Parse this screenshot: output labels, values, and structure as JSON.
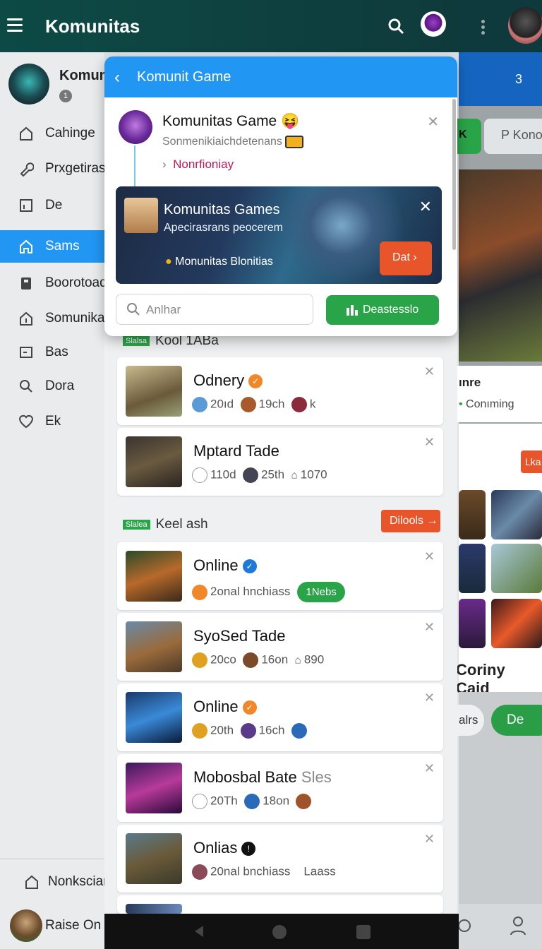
{
  "topbar": {
    "title": "Komunitas"
  },
  "right": {
    "blue_badge": "3",
    "btn_dark": "K",
    "btn_light": "P Kono",
    "card_title": "ınre",
    "card_sub": "Conıming",
    "label": "Lka",
    "caption": "Coriny Caid",
    "pill1": "alrs",
    "pill2": "De"
  },
  "drawer": {
    "name": "Komunı",
    "badge": "1",
    "items": [
      {
        "label": "Cahinge",
        "icon": "house-icon"
      },
      {
        "label": "Prxgetiras",
        "icon": "wrench-icon"
      },
      {
        "label": "De",
        "icon": "calendar-icon"
      },
      {
        "label": "Sams",
        "icon": "home-icon",
        "active": true
      },
      {
        "label": "Boorotoad",
        "icon": "clipboard-icon"
      },
      {
        "label": "Somunika",
        "icon": "home-outline-icon"
      },
      {
        "label": "Bas",
        "icon": "minus-box-icon"
      },
      {
        "label": "Dora",
        "icon": "search-icon"
      },
      {
        "label": "Ek",
        "icon": "heart-icon"
      }
    ],
    "bottom1": "Nonksciar",
    "bottom2": "Raise On"
  },
  "popup": {
    "header": "Komunit Game",
    "title": "Komunitas Game",
    "subtitle": "Sonmenikiaichdetenans",
    "notif": "Nonrfioniay",
    "banner": {
      "title": "Komunitas Games",
      "sub": "Apecirasrans peocerem",
      "label": "Monunitas Blonitias",
      "btn": "Dat"
    },
    "search_placeholder": "Anlhar",
    "green_btn": "Deastesslo"
  },
  "sections": [
    {
      "tag": "Slalsa",
      "title": "Kool 1ABa"
    },
    {
      "tag": "Slalea",
      "title": "Keel ash",
      "btn": "Dilools"
    }
  ],
  "cards": [
    {
      "title": "Odnery",
      "badge_color": "#f0882a",
      "m1": "20ıd",
      "m2": "19ch",
      "m3": "k",
      "m1c": "#5b9bd5",
      "m2c": "#a85a2a",
      "m3c": "#8a2a3a",
      "thumb": "linear-gradient(160deg,#c9b98f,#6a5a3a 60%,#9aa07a)"
    },
    {
      "title": "Mptard Tade",
      "badge_color": "",
      "m1": "110d",
      "m2": "25th",
      "m3": "1070",
      "m1c": "#ddd",
      "m2c": "#445",
      "m3c": "#eee",
      "thumb": "linear-gradient(160deg,#3a3530,#6a5a40 50%,#2a2520)"
    },
    {
      "title": "Online",
      "badge_color": "#1e7ad8",
      "m1": "2onal hnchiass",
      "m2": "",
      "m3": "",
      "green": "1Nebs",
      "m1c": "#f0882a",
      "thumb": "linear-gradient(160deg,#2a4a2a,#b8692a 50%,#3a2a1a)"
    },
    {
      "title": "SyoSed Tade",
      "badge_color": "",
      "m1": "20co",
      "m2": "16on",
      "m3": "890",
      "m1c": "#e0a020",
      "m2c": "#7a4a2a",
      "m3c": "#eee",
      "thumb": "linear-gradient(160deg,#6a8aa8,#9a6a3a 55%,#4a3a2a)"
    },
    {
      "title": "Online",
      "badge_color": "#f0882a",
      "m1": "20th",
      "m2": "16ch",
      "m3": "",
      "m1c": "#e0a020",
      "m2c": "#5a3a8a",
      "m3c": "#2a6ab8",
      "thumb": "linear-gradient(160deg,#1a3a6a,#3a8ad8 50%,#0a1a3a)"
    },
    {
      "title": "Mobosbal Bate",
      "badge_color": "",
      "suffix": "Sles",
      "m1": "20Th",
      "m2": "18on",
      "m3": "",
      "m1c": "#ddd",
      "m2c": "#2a6ab8",
      "m3c": "#a0522a",
      "thumb": "linear-gradient(160deg,#3a1a5a,#b83a9a 50%,#2a0a3a)"
    },
    {
      "title": "Onlias",
      "badge_color": "#111",
      "m1": "20nal bnchiass",
      "m2": "",
      "m3": "",
      "tail": "Laass",
      "m1c": "#8a4a5a",
      "thumb": "linear-gradient(160deg,#5a7a8a,#6a5a3a 50%,#3a3a2a)"
    }
  ]
}
